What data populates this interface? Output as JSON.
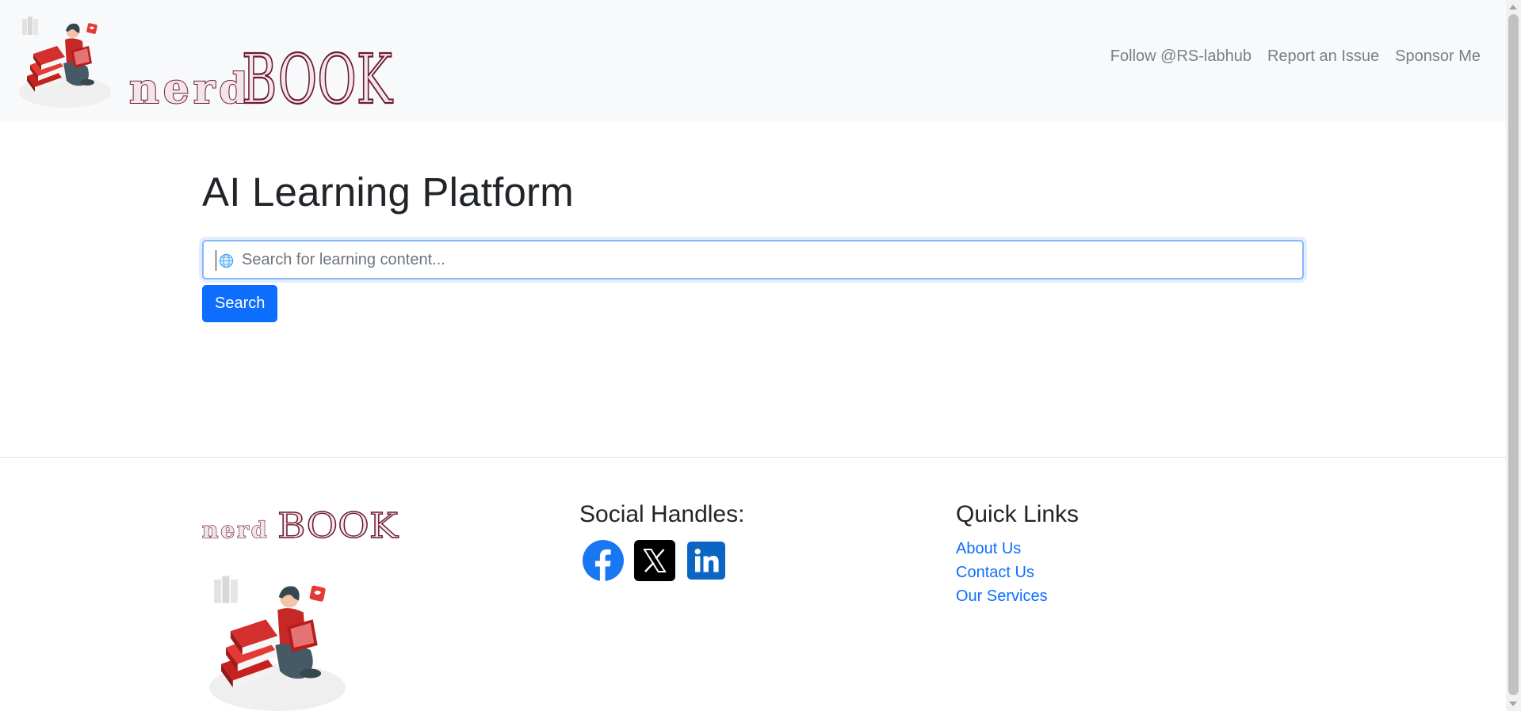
{
  "brand": {
    "name": "nerdBOOK",
    "word_parts": {
      "lower": "nerd",
      "upper": "BOOK"
    },
    "color": "#6b1a2f"
  },
  "nav": {
    "links": [
      {
        "label": "Follow @RS-labhub"
      },
      {
        "label": "Report an Issue"
      },
      {
        "label": "Sponsor Me"
      }
    ]
  },
  "main": {
    "title": "AI Learning Platform",
    "search": {
      "value": "",
      "placeholder": "Search for learning content...",
      "icon": "globe-icon"
    },
    "search_button_label": "Search"
  },
  "footer": {
    "social_heading": "Social Handles:",
    "social": [
      {
        "icon": "facebook-icon",
        "color": "#1877f2"
      },
      {
        "icon": "x-twitter-icon",
        "color": "#000000"
      },
      {
        "icon": "linkedin-icon",
        "color": "#0a66c2"
      }
    ],
    "quick_links_heading": "Quick Links",
    "quick_links": [
      {
        "label": "About Us"
      },
      {
        "label": "Contact Us"
      },
      {
        "label": "Our Services"
      }
    ]
  },
  "colors": {
    "navbar_bg": "#f8f9fa",
    "primary": "#0d6efd",
    "nav_link": "#7a7f86",
    "focus_border": "#86b7fe"
  }
}
